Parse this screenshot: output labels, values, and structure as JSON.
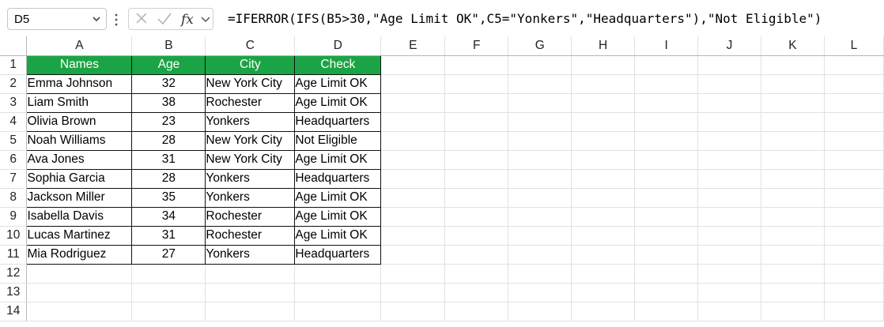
{
  "formula_bar": {
    "name_box": "D5",
    "formula": "=IFERROR(IFS(B5>30,\"Age Limit OK\",C5=\"Yonkers\",\"Headquarters\"),\"Not Eligible\")",
    "icons": [
      "chevron-down-icon",
      "more-options-icon",
      "cancel-icon",
      "enter-icon",
      "function-icon",
      "chevron-down-icon"
    ]
  },
  "grid": {
    "columns": [
      "A",
      "B",
      "C",
      "D",
      "E",
      "F",
      "G",
      "H",
      "I",
      "J",
      "K",
      "L"
    ],
    "rows": [
      "1",
      "2",
      "3",
      "4",
      "5",
      "6",
      "7",
      "8",
      "9",
      "10",
      "11",
      "12",
      "13",
      "14"
    ],
    "header_fill": "#1BA446",
    "table": {
      "headers": [
        "Names",
        "Age",
        "City",
        "Check"
      ],
      "data": [
        [
          "Emma Johnson",
          "32",
          "New York City",
          "Age Limit OK"
        ],
        [
          "Liam Smith",
          "38",
          "Rochester",
          "Age Limit OK"
        ],
        [
          "Olivia Brown",
          "23",
          "Yonkers",
          "Headquarters"
        ],
        [
          "Noah Williams",
          "28",
          "New York City",
          "Not Eligible"
        ],
        [
          "Ava Jones",
          "31",
          "New York City",
          "Age Limit OK"
        ],
        [
          "Sophia Garcia",
          "28",
          "Yonkers",
          "Headquarters"
        ],
        [
          "Jackson Miller",
          "35",
          "Yonkers",
          "Age Limit OK"
        ],
        [
          "Isabella Davis",
          "34",
          "Rochester",
          "Age Limit OK"
        ],
        [
          "Lucas Martinez",
          "31",
          "Rochester",
          "Age Limit OK"
        ],
        [
          "Mia Rodriguez",
          "27",
          "Yonkers",
          "Headquarters"
        ]
      ]
    }
  }
}
